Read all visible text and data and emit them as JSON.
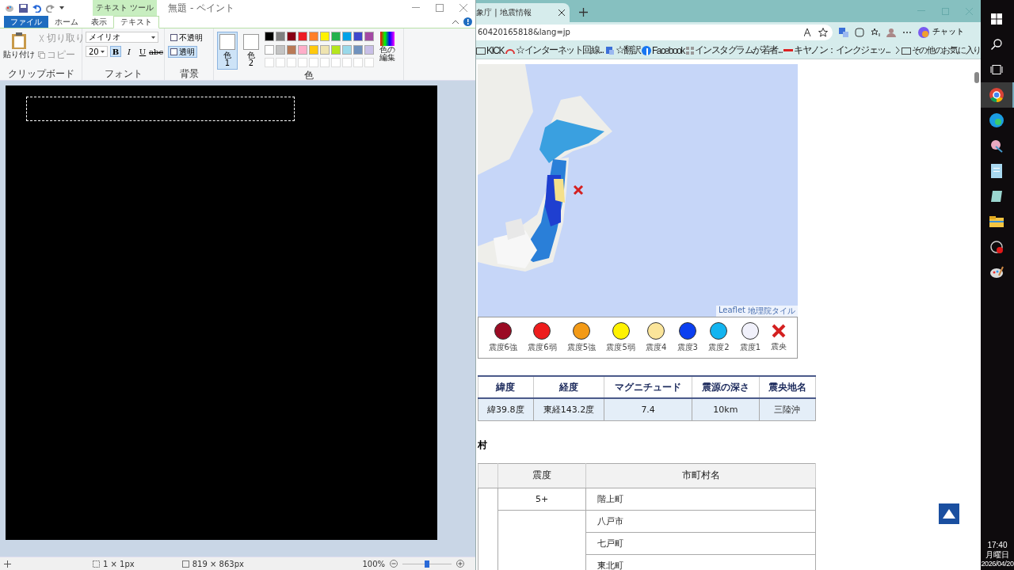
{
  "paint": {
    "title": "無題 - ペイント",
    "context_tab": "テキスト ツール",
    "tabs": [
      {
        "label": "ファイル",
        "kind": "file",
        "selected": false
      },
      {
        "label": "ホーム",
        "kind": "tab",
        "selected": false
      },
      {
        "label": "表示",
        "kind": "tab",
        "selected": false
      },
      {
        "label": "テキスト",
        "kind": "tab",
        "selected": true
      }
    ],
    "clipboard": {
      "paste": "貼り付け",
      "cut": {
        "label": "切り取り",
        "disabled": true
      },
      "copy": {
        "label": "コピー",
        "disabled": true
      },
      "group": "クリップボード"
    },
    "font": {
      "family": "メイリオ",
      "size": "20",
      "styles": [
        {
          "label": "B",
          "kind": "bold",
          "selected": true
        },
        {
          "label": "I",
          "kind": "italic",
          "selected": false
        },
        {
          "label": "U",
          "kind": "underline",
          "selected": false
        },
        {
          "label": "abc",
          "kind": "strike",
          "selected": false
        }
      ],
      "group": "フォント"
    },
    "background": {
      "options": [
        {
          "label": "不透明",
          "selected": false
        },
        {
          "label": "透明",
          "selected": true
        }
      ],
      "group": "背景"
    },
    "colors": {
      "slots": [
        {
          "label": "色",
          "number": "1",
          "color": "#ffffff",
          "selected": true
        },
        {
          "label": "色",
          "number": "2",
          "color": "#ffffff",
          "selected": false
        }
      ],
      "palette": [
        {
          "color": "#000000"
        },
        {
          "color": "#7f7f7f"
        },
        {
          "color": "#880015"
        },
        {
          "color": "#ed1c24"
        },
        {
          "color": "#ff7f27"
        },
        {
          "color": "#fff200"
        },
        {
          "color": "#22b14c"
        },
        {
          "color": "#00a2e8"
        },
        {
          "color": "#3f48cc"
        },
        {
          "color": "#a349a4"
        },
        {
          "color": "#ffffff"
        },
        {
          "color": "#c3c3c3"
        },
        {
          "color": "#b97a57"
        },
        {
          "color": "#ffaec9"
        },
        {
          "color": "#ffc90e"
        },
        {
          "color": "#efe4b0"
        },
        {
          "color": "#b5e61d"
        },
        {
          "color": "#99d9ea"
        },
        {
          "color": "#7092be"
        },
        {
          "color": "#c8bfe7"
        }
      ],
      "edit": "色の編集",
      "group": "色"
    },
    "status": {
      "selection": "1 × 1px",
      "canvas_size": "819 × 863px",
      "zoom": "100%",
      "level": 0.5
    }
  },
  "browser": {
    "tab_title": "象庁 | 地震情報",
    "address": "60420165818&lang=jp",
    "copilot": "チャット",
    "bookmarks": [
      {
        "label": "KICK",
        "kind": "folder"
      },
      {
        "label": "☆インターネット回線...",
        "kind": "gauge"
      },
      {
        "label": "☆翻訳",
        "kind": "translate"
      },
      {
        "label": "Facebook",
        "kind": "facebook"
      },
      {
        "label": "インスタグラムが若者...",
        "kind": "grid"
      },
      {
        "label": "キヤノン：インクジェッ...",
        "kind": "dash"
      }
    ],
    "other_favorites": "その他のお気に入り",
    "map": {
      "kind": "picture",
      "attribution": [
        "Leaflet",
        "地理院タイル"
      ]
    },
    "legend": [
      {
        "label": "震度6強",
        "kind": "dot",
        "color": "#9b0b24"
      },
      {
        "label": "震度6弱",
        "kind": "dot",
        "color": "#ee1c1c"
      },
      {
        "label": "震度5強",
        "kind": "dot",
        "color": "#f39a16"
      },
      {
        "label": "震度5弱",
        "kind": "dot",
        "color": "#fff200"
      },
      {
        "label": "震度4",
        "kind": "dot",
        "color": "#fbe59a"
      },
      {
        "label": "震度3",
        "kind": "dot",
        "color": "#0b3ff0"
      },
      {
        "label": "震度2",
        "kind": "dot",
        "color": "#13b4f0"
      },
      {
        "label": "震度1",
        "kind": "dot",
        "color": "#f1f1fb"
      },
      {
        "label": "震央",
        "kind": "cross",
        "color": "#d42020"
      }
    ],
    "quake_table": {
      "columns": [
        "緯度",
        "経度",
        "マグニチュード",
        "震源の深さ",
        "震央地名"
      ],
      "rows": [
        [
          "緯39.8度",
          "東経143.2度",
          "7.4",
          "10km",
          "三陸沖"
        ]
      ]
    },
    "section_heading": "村",
    "city_table": {
      "columns": [
        "震度",
        "市町村名"
      ],
      "groups": [
        {
          "intensity": "5+",
          "cities": [
            "階上町"
          ]
        },
        {
          "cities": [
            "八戸市",
            "七戸町",
            "東北町"
          ]
        }
      ]
    }
  },
  "taskbar": {
    "apps": [
      {
        "kind": "chrome",
        "selected": true
      },
      {
        "kind": "edge",
        "selected": false
      },
      {
        "kind": "tool",
        "selected": false
      },
      {
        "kind": "notepad",
        "selected": false
      },
      {
        "kind": "doc",
        "selected": false
      },
      {
        "kind": "folder",
        "selected": false
      },
      {
        "kind": "record",
        "selected": false
      },
      {
        "kind": "paint",
        "selected": false
      }
    ],
    "time": "17:40",
    "weekday": "月曜日",
    "date": "2026/04/20"
  }
}
